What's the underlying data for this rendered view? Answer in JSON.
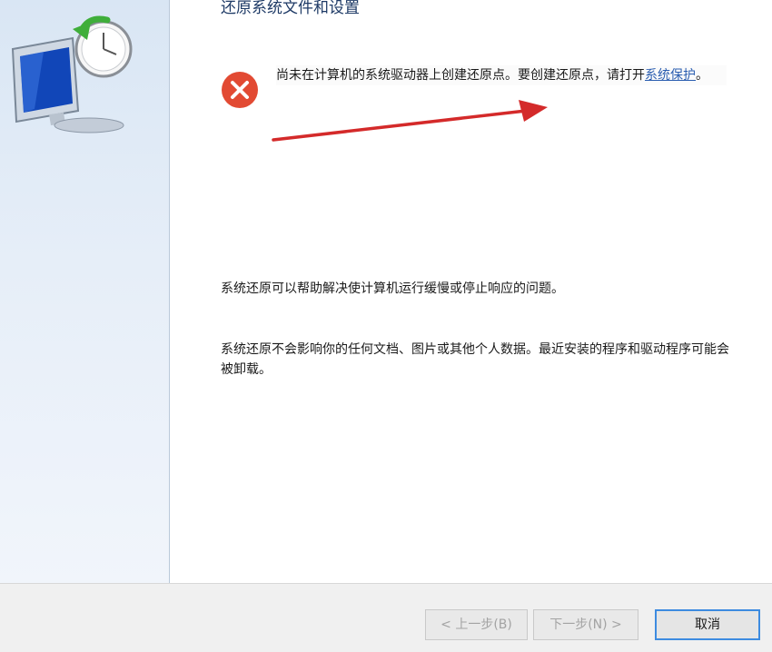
{
  "header": {
    "title": "还原系统文件和设置"
  },
  "error": {
    "message": "尚未在计算机的系统驱动器上创建还原点。要创建还原点，请打开",
    "link": "系统保护",
    "suffix": "。"
  },
  "body": {
    "paragraph1": "系统还原可以帮助解决使计算机运行缓慢或停止响应的问题。",
    "paragraph2": "系统还原不会影响你的任何文档、图片或其他个人数据。最近安装的程序和驱动程序可能会被卸载。"
  },
  "footer": {
    "back_label": "< 上一步(B)",
    "next_label": "下一步(N) >",
    "cancel_label": "取消"
  },
  "colors": {
    "error_red": "#e24a33",
    "annotation_arrow": "#d42a2a",
    "link_blue": "#2a5db0",
    "focus_border": "#3d8be0"
  },
  "icons": {
    "hero": "system-restore-icon",
    "error": "error-icon",
    "annotation": "red-arrow-annotation"
  },
  "state": {
    "back_enabled": false,
    "next_enabled": false
  }
}
